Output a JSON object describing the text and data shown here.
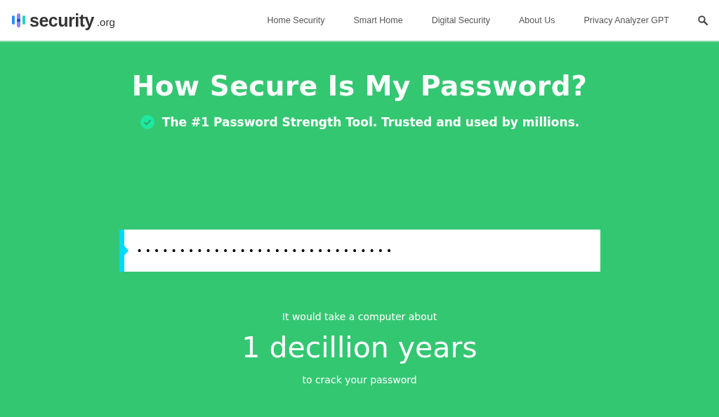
{
  "header": {
    "logo": {
      "name": "security",
      "suffix": ".org"
    },
    "nav": [
      {
        "label": "Home Security"
      },
      {
        "label": "Smart Home"
      },
      {
        "label": "Digital Security"
      },
      {
        "label": "About Us"
      },
      {
        "label": "Privacy Analyzer GPT"
      }
    ]
  },
  "hero": {
    "title": "How Secure Is My Password?",
    "tagline": "The #1 Password Strength Tool. Trusted and used by millions."
  },
  "password_field": {
    "value": "••••••••••••••••••••••••••••••"
  },
  "result": {
    "intro": "It would take a computer about",
    "duration": "1 decillion years",
    "outro": "to crack your password"
  }
}
